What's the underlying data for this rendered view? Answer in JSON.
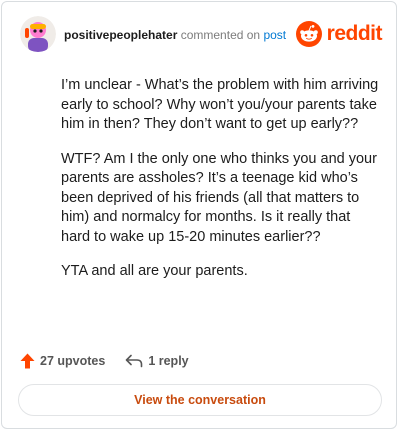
{
  "header": {
    "username": "positivepeoplehater",
    "commented_label": "commented on",
    "post_label": "post",
    "logo_text": "reddit"
  },
  "comment": {
    "paragraphs": [
      "I’m unclear - What’s the problem with him arriving early to school? Why won’t you/your parents take him in then? They don’t want to get up early??",
      "WTF? Am I the only one who thinks you and your parents are assholes? It’s a teenage kid who’s been deprived of his friends (all that matters to him) and normalcy for months. Is it really that hard to wake up 15-20 minutes earlier??",
      "YTA and all are your parents."
    ]
  },
  "actions": {
    "upvotes": "27 upvotes",
    "replies": "1 reply"
  },
  "footer": {
    "view_button": "View the conversation"
  },
  "colors": {
    "brand": "#ff4500",
    "link": "#0079d3",
    "button_text": "#c84b0e"
  },
  "icons": {
    "avatar": "avatar",
    "logo": "reddit-logo-icon",
    "upvote": "upvote-arrow-icon",
    "reply": "reply-arrow-icon"
  }
}
